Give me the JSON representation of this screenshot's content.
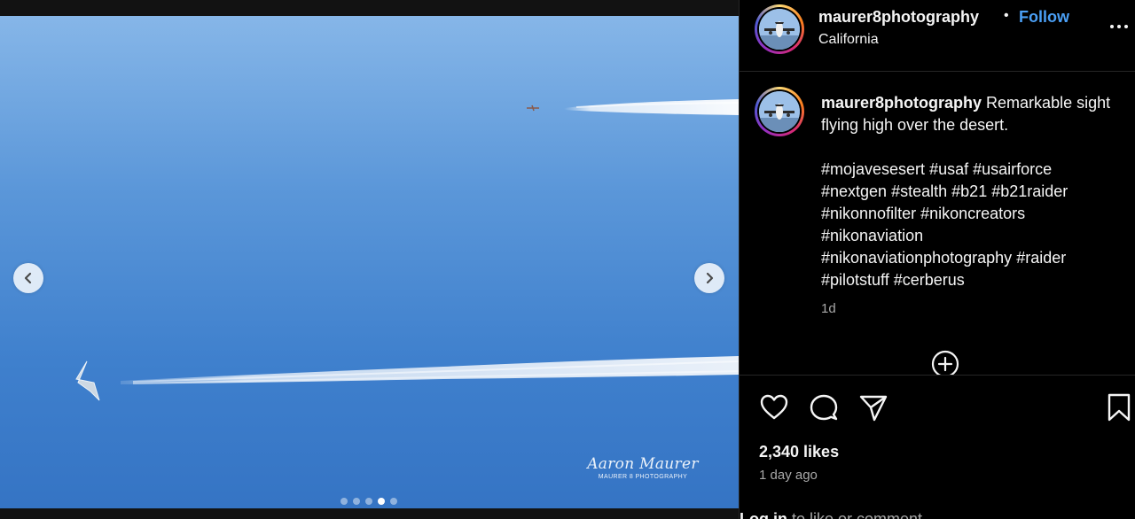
{
  "post": {
    "username": "maurer8photography",
    "separator": "•",
    "follow_label": "Follow",
    "location": "California"
  },
  "media": {
    "watermark_name": "Aaron Maurer",
    "watermark_sub": "MAURER 8 PHOTOGRAPHY",
    "carousel": {
      "total": 5,
      "active_index": 3
    }
  },
  "caption": {
    "username": "maurer8photography",
    "text": "Remarkable sight flying high over the desert.",
    "hashtags": [
      "#mojavesesert",
      "#usaf",
      "#usairforce",
      "#nextgen",
      "#stealth",
      "#b21",
      "#b21raider",
      "#nikonnofilter",
      "#nikoncreators",
      "#nikonaviation",
      "#nikonaviationphotography",
      "#raider",
      "#pilotstuff",
      "#cerberus"
    ],
    "time": "1d"
  },
  "stats": {
    "likes": "2,340 likes",
    "time_ago": "1 day ago"
  },
  "login": {
    "link": "Log in",
    "rest": " to like or comment."
  },
  "icons": {
    "prev": "chevron-left-icon",
    "next": "chevron-right-icon",
    "more": "more-horizontal-icon",
    "load": "plus-circle-icon",
    "like": "heart-icon",
    "comment": "comment-icon",
    "share": "send-icon",
    "save": "bookmark-icon"
  },
  "colors": {
    "follow": "#4a9ff5",
    "sky_top": "#86b6e8",
    "sky_bottom": "#3574c4",
    "muted_text": "#a8a8a8"
  }
}
